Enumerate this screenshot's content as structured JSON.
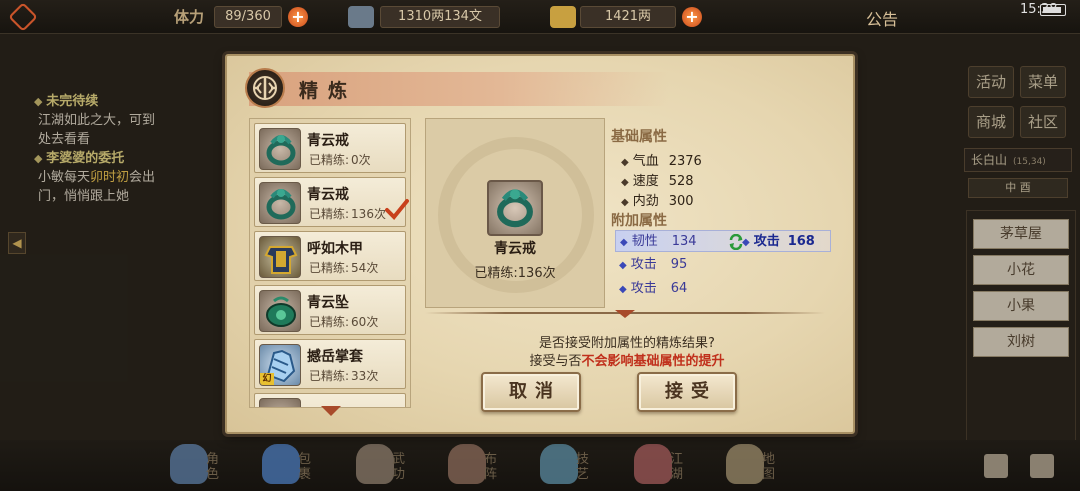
{
  "hud": {
    "stamina_label": "体力",
    "stamina_value": "89/360",
    "silver_value": "1310两134文",
    "gold_value": "1421两",
    "notice_label": "公告",
    "clock": "15:38"
  },
  "quests": [
    {
      "title": "未完待续",
      "desc_lines": [
        "江湖如此之大，可到",
        "处去看看"
      ]
    },
    {
      "title": "李婆婆的委托",
      "desc_pre": "小敏每天",
      "desc_highlight": "卯时初",
      "desc_post": "会出",
      "desc_line2": "门，悄悄跟上她"
    }
  ],
  "side_menu": {
    "activity": "活动",
    "menu": "菜单",
    "shop": "商城",
    "community": "社区"
  },
  "location": {
    "name": "长白山",
    "coords": "(15,34)",
    "direction": "中 酉"
  },
  "npcs": [
    "茅草屋",
    "小花",
    "小果",
    "刘树"
  ],
  "dock": [
    {
      "label": "角色",
      "color": "#5a7aa0"
    },
    {
      "label": "包裹",
      "color": "#4a78b8"
    },
    {
      "label": "武功",
      "color": "#8a7a6a"
    },
    {
      "label": "布阵",
      "color": "#8a6a5a"
    },
    {
      "label": "技艺",
      "color": "#5a8aa0"
    },
    {
      "label": "江湖",
      "color": "#a05a5a"
    },
    {
      "label": "地图",
      "color": "#9a8a6a"
    }
  ],
  "dialog": {
    "title": "精炼",
    "items": [
      {
        "name": "青云戒",
        "refine_label": "已精练:",
        "count": "0次",
        "icon": "ring-icon"
      },
      {
        "name": "青云戒",
        "refine_label": "已精练:",
        "count": "136次",
        "icon": "ring-icon",
        "selected": true
      },
      {
        "name": "呼如木甲",
        "refine_label": "已精练:",
        "count": "54次",
        "icon": "armor-icon"
      },
      {
        "name": "青云坠",
        "refine_label": "已精练:",
        "count": "60次",
        "icon": "pendant-icon"
      },
      {
        "name": "撼岳掌套",
        "refine_label": "已精练:",
        "count": "33次",
        "icon": "gauntlet-icon",
        "badge": "幻"
      }
    ],
    "preview": {
      "name": "青云戒",
      "refined": "已精练:136次"
    },
    "base_title": "基础属性",
    "base_attrs": [
      {
        "name": "气血",
        "value": "2376"
      },
      {
        "name": "速度",
        "value": "528"
      },
      {
        "name": "内劲",
        "value": "300"
      }
    ],
    "bonus_title": "附加属性",
    "bonus_attrs": [
      {
        "name": "韧性",
        "value": "134",
        "new_name": "攻击",
        "new_value": "168"
      },
      {
        "name": "攻击",
        "value": "95"
      },
      {
        "name": "攻击",
        "value": "64"
      }
    ],
    "prompt_line1": "是否接受附加属性的精炼结果?",
    "prompt_line2_pre": "接受与否",
    "prompt_line2_red": "不会影响基础属性的提升",
    "cancel_label": "取消",
    "accept_label": "接受"
  }
}
